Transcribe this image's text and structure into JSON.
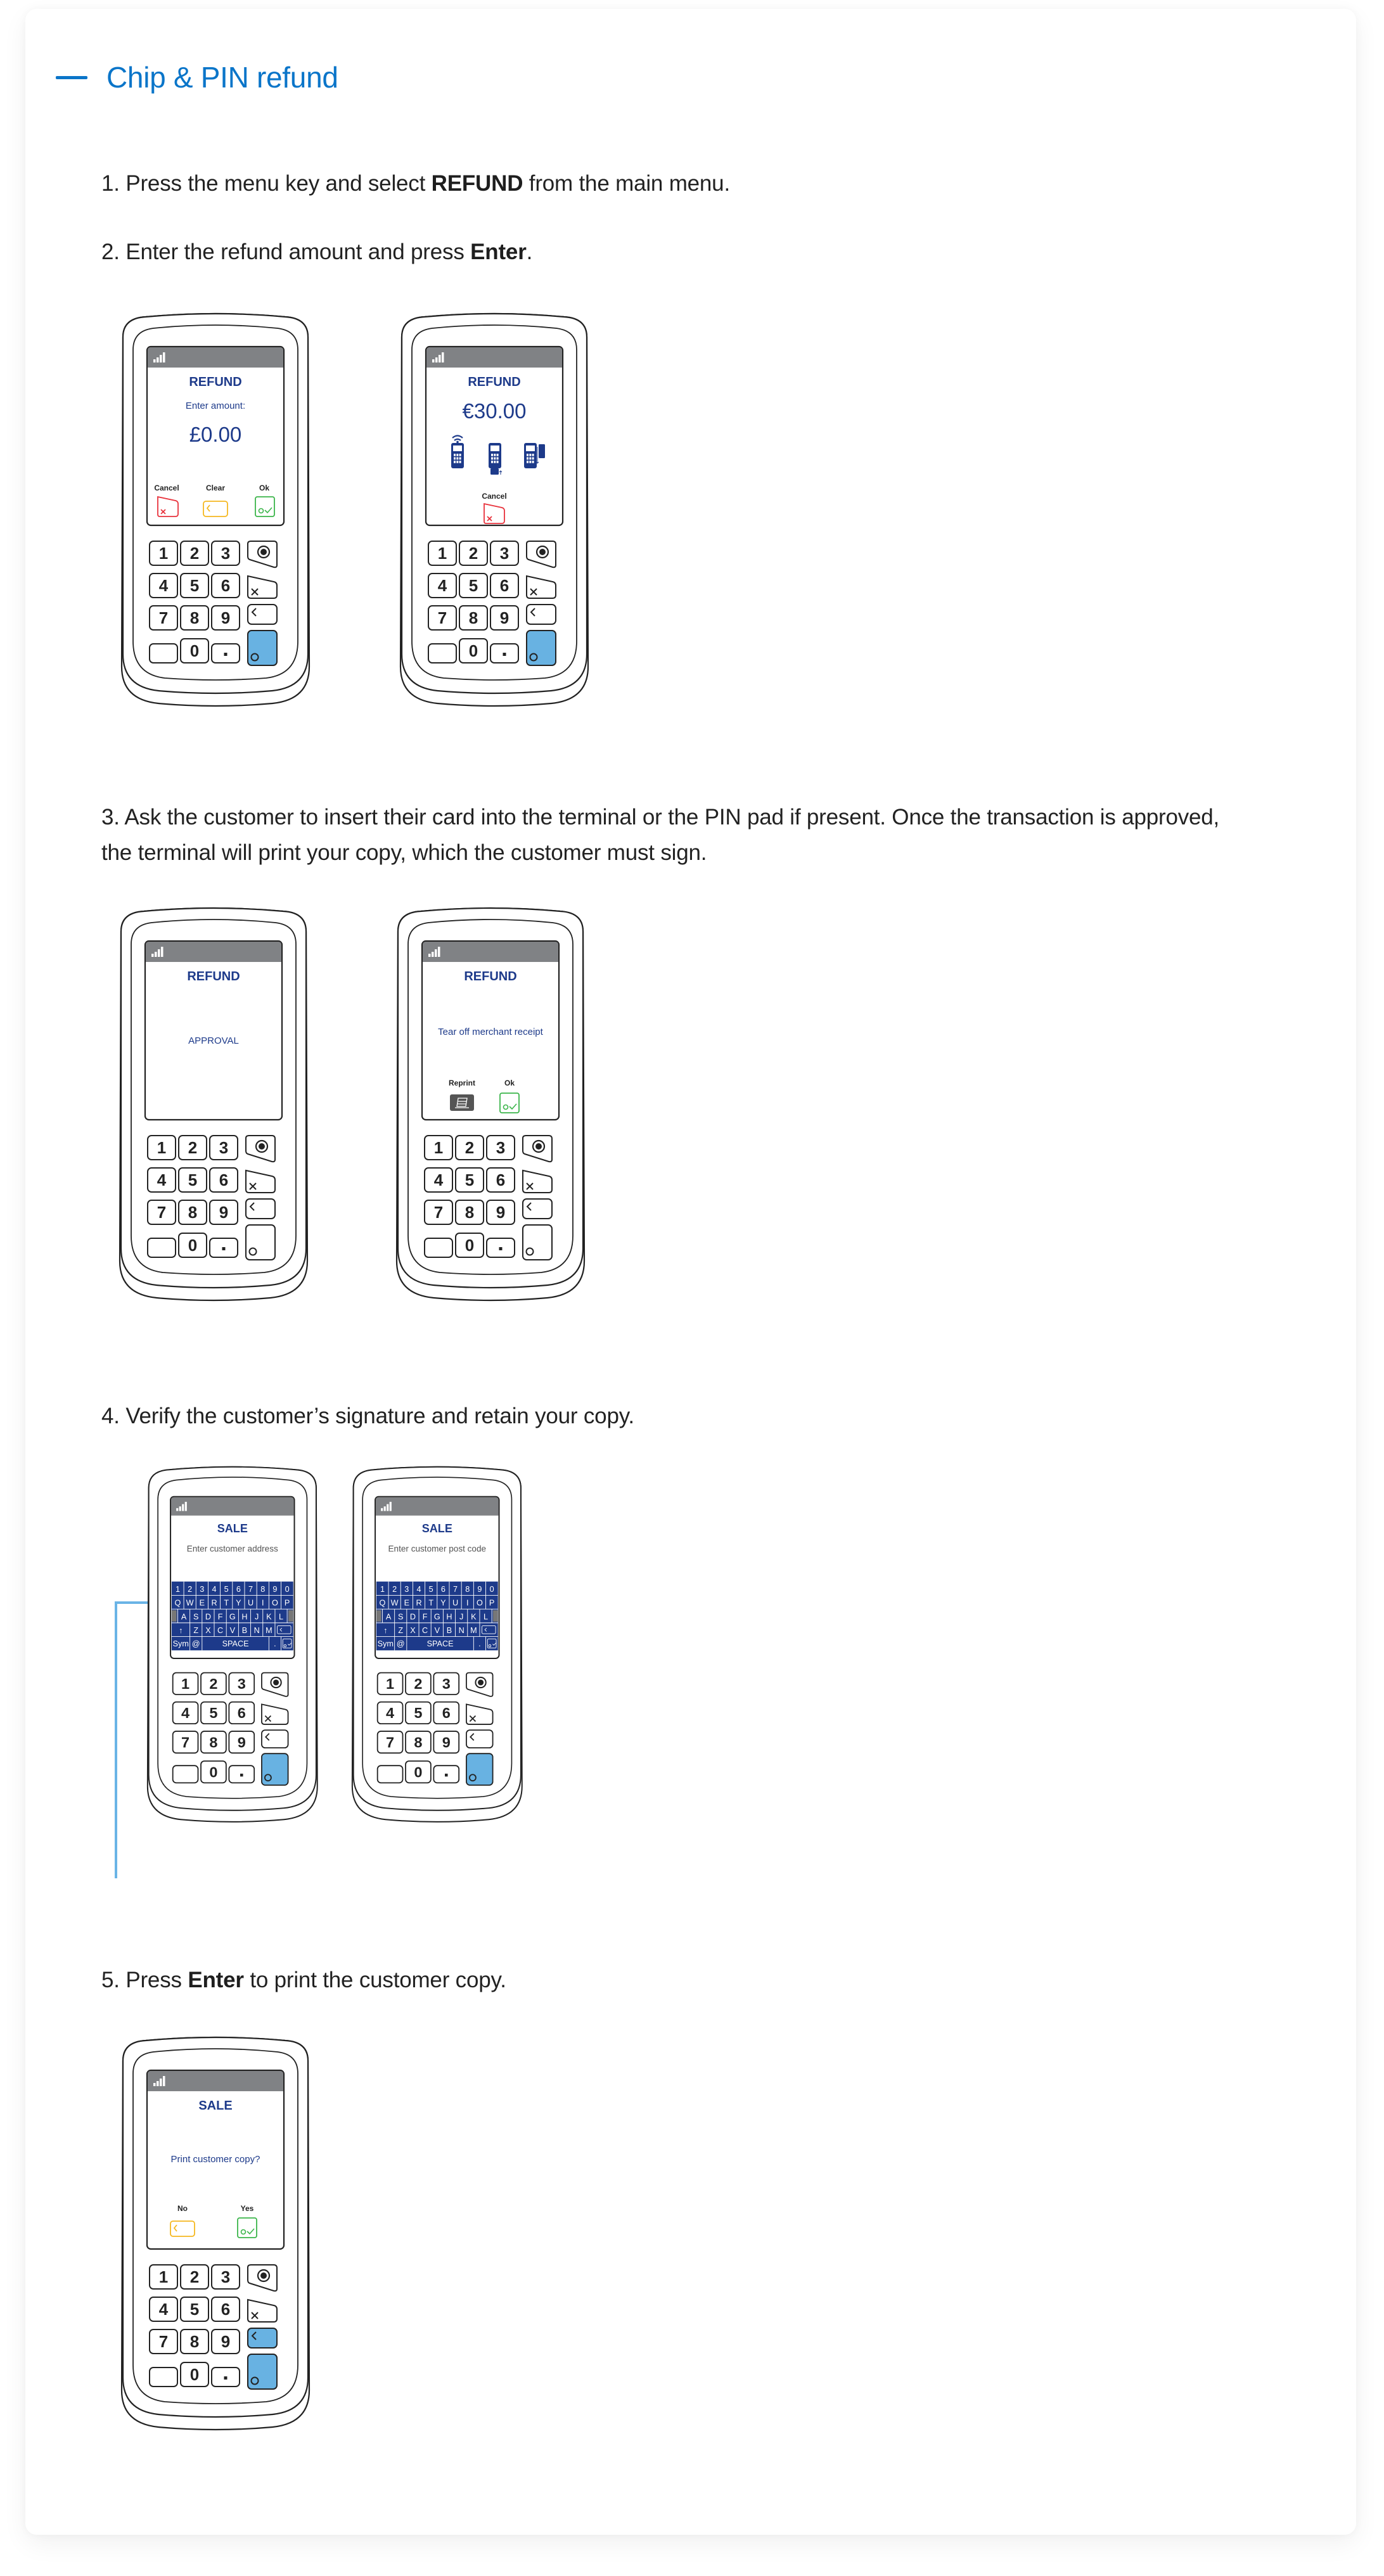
{
  "section": {
    "title": "Chip & PIN refund",
    "title_color": "#0a75c9",
    "dash_icon": "minus-collapse-icon"
  },
  "steps": [
    {
      "number": "1.",
      "pre": "Press the menu key and select ",
      "bold": "REFUND",
      "post": " from the main menu."
    },
    {
      "number": "2.",
      "pre": "Enter the refund amount and press ",
      "bold": "Enter",
      "post": "."
    },
    {
      "number": "3.",
      "line1": "Ask the customer to insert their card into the terminal or the PIN pad if present. Once the transaction is approved,",
      "line2": "the terminal will print your copy, which the customer must sign."
    },
    {
      "number": "4.",
      "text": "Verify the customer’s signature and retain your copy."
    },
    {
      "number": "5.",
      "pre": "Press ",
      "bold": "Enter",
      "post": " to print the customer copy."
    }
  ],
  "terminals": {
    "t1": {
      "header": "REFUND",
      "prompt": "Enter amount:",
      "amount": "£0.00",
      "softkeys": [
        "Cancel",
        "Clear",
        "Ok"
      ]
    },
    "t2": {
      "header": "REFUND",
      "amount": "€30.00",
      "payment_icons": [
        "contactless-terminal-icon",
        "chip-insert-terminal-icon",
        "swipe-terminal-icon"
      ],
      "softkeys": [
        "Cancel"
      ]
    },
    "t3": {
      "header": "REFUND",
      "message": "APPROVAL"
    },
    "t4": {
      "header": "REFUND",
      "message": "Tear off merchant receipt",
      "softkeys": [
        "Reprint",
        "Ok"
      ]
    },
    "t5": {
      "header": "SALE",
      "prompt": "Enter customer address"
    },
    "t6": {
      "header": "SALE",
      "prompt": "Enter customer post code"
    },
    "t7": {
      "header": "SALE",
      "message": "Print customer copy?",
      "softkeys": [
        "No",
        "Yes"
      ]
    }
  },
  "keyboard": {
    "row1": [
      "1",
      "2",
      "3",
      "4",
      "5",
      "6",
      "7",
      "8",
      "9",
      "0"
    ],
    "row2": [
      "Q",
      "W",
      "E",
      "R",
      "T",
      "Y",
      "U",
      "I",
      "O",
      "P"
    ],
    "row3": [
      "A",
      "S",
      "D",
      "F",
      "G",
      "H",
      "J",
      "K",
      "L"
    ],
    "row4": [
      "↑",
      "Z",
      "X",
      "C",
      "V",
      "B",
      "N",
      "M"
    ],
    "row5": [
      "Sym",
      "@",
      "SPACE",
      "."
    ]
  },
  "keypad": {
    "keys": [
      "1",
      "2",
      "3",
      "4",
      "5",
      "6",
      "7",
      "8",
      "9",
      "0",
      "·"
    ]
  },
  "colors": {
    "screen_blue": "#1d3a8a",
    "enter_key": "#68b2e2",
    "cancel_red": "#e8323c",
    "clear_yellow": "#f5b820",
    "ok_green": "#3bb54a",
    "status_bar": "#808285",
    "keyboard_bg": "#1d3a8a"
  }
}
